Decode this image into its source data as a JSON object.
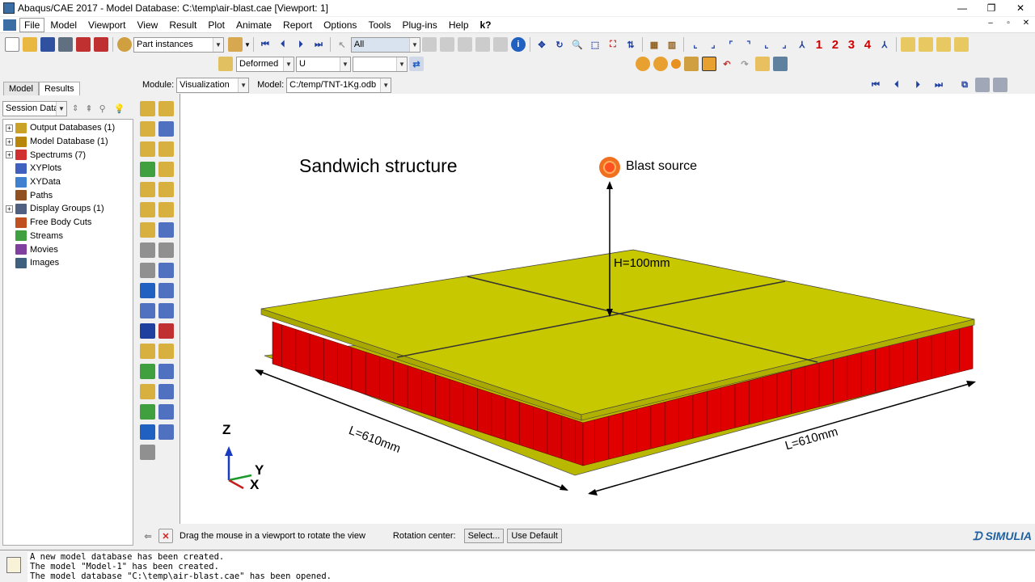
{
  "window": {
    "title": "Abaqus/CAE 2017 - Model Database: C:\\temp\\air-blast.cae [Viewport: 1]",
    "minimize": "—",
    "restore": "❐",
    "close": "✕"
  },
  "menubar": {
    "items": [
      "File",
      "Model",
      "Viewport",
      "View",
      "Result",
      "Plot",
      "Animate",
      "Report",
      "Options",
      "Tools",
      "Plug-ins",
      "Help",
      "k?"
    ],
    "mdi": [
      "–",
      "▫",
      "✕"
    ]
  },
  "toolbar": {
    "part_combo": "Part instances",
    "select_combo": "All",
    "deformed_combo": "Deformed",
    "variable_combo": "U",
    "component_combo": "",
    "stage_combo": "",
    "numbers": [
      "1",
      "2",
      "3",
      "4"
    ]
  },
  "modulebar": {
    "module_label": "Module:",
    "module_value": "Visualization",
    "model_label": "Model:",
    "model_value": "C:/temp/TNT-1Kg.odb"
  },
  "leftpanel": {
    "tabs": [
      "Model",
      "Results"
    ],
    "session_combo": "Session Data",
    "tree": [
      {
        "label": "Output Databases (1)",
        "expandable": true,
        "color": "#c9a227"
      },
      {
        "label": "Model Database (1)",
        "expandable": true,
        "color": "#b8860b"
      },
      {
        "label": "Spectrums (7)",
        "expandable": true,
        "color": "#d03030"
      },
      {
        "label": "XYPlots",
        "expandable": false,
        "color": "#4060c0"
      },
      {
        "label": "XYData",
        "expandable": false,
        "color": "#4080d0"
      },
      {
        "label": "Paths",
        "expandable": false,
        "color": "#905020"
      },
      {
        "label": "Display Groups (1)",
        "expandable": true,
        "color": "#506080"
      },
      {
        "label": "Free Body Cuts",
        "expandable": false,
        "color": "#c05020"
      },
      {
        "label": "Streams",
        "expandable": false,
        "color": "#40a040"
      },
      {
        "label": "Movies",
        "expandable": false,
        "color": "#8040a0"
      },
      {
        "label": "Images",
        "expandable": false,
        "color": "#406080"
      }
    ]
  },
  "viewport": {
    "title_annotation": "Sandwich structure",
    "blast_label": "Blast source",
    "height_label": "H=100mm",
    "length_left": "L=610mm",
    "length_right": "L=610mm",
    "axis_z": "Z",
    "axis_y": "Y",
    "axis_x": "X",
    "colors": {
      "face": "#c8c800",
      "core": "#e00000",
      "blast": "#f07020"
    }
  },
  "promptbar": {
    "prompt": "Drag the mouse in a viewport to rotate the view",
    "rotation_label": "Rotation center:",
    "select_button": "Select...",
    "default_button": "Use Default",
    "brand": "SIMULIA"
  },
  "messages": [
    "A new model database has been created.",
    "The model \"Model-1\" has been created.",
    "The model database \"C:\\temp\\air-blast.cae\" has been opened."
  ]
}
